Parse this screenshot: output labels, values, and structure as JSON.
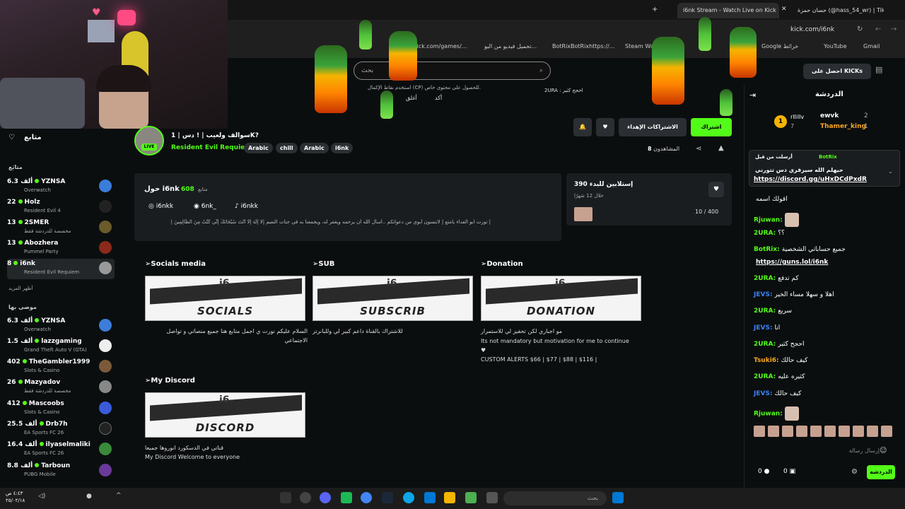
{
  "browser": {
    "tabs": [
      {
        "label": "حسان حمزة (@hass_54_wr) | TikTok",
        "active": false
      },
      {
        "label": "i6nk Stream - Watch Live on Kick",
        "active": true
      }
    ],
    "url": "kick.com/i6nk",
    "bookmarks": [
      "kick.com/games/...",
      "تحميل فيديو من اليو...",
      "BotRixBotRixhttps://...",
      "Steam Worksho...",
      "Google خرائط",
      "YouTube",
      "Gmail"
    ]
  },
  "site": {
    "search_placeholder": "بحث",
    "kicks_button": "احصل على KICKs",
    "notice_line": "استخدم نقاط الإكمال (CP) للحصول على محتوى خاص.",
    "notice_user": "2URA : احجح كثير",
    "notice_yes": "أكد",
    "notice_close": "أغلق"
  },
  "left_sidebar": {
    "following_heading": "متابع",
    "following_section": "متابَع",
    "show_more": "أظهر المزيد",
    "recommended_section": "موصى بها",
    "following": [
      {
        "viewers": "6.3 ألف",
        "name": "YZNSA",
        "game": "Overwatch",
        "selected": false
      },
      {
        "viewers": "22",
        "name": "Holz",
        "game": "Resident Evil 4",
        "selected": false
      },
      {
        "viewers": "13",
        "name": "2SMER",
        "game": "مخصصة للدردشة فقط",
        "selected": false
      },
      {
        "viewers": "13",
        "name": "Abozhera",
        "game": "Pummel Party",
        "selected": false
      },
      {
        "viewers": "8",
        "name": "i6nk",
        "game": "Resident Evil Requiem",
        "selected": true
      }
    ],
    "recommended": [
      {
        "viewers": "6.3 ألف",
        "name": "YZNSA",
        "game": "Overwatch"
      },
      {
        "viewers": "1.5 ألف",
        "name": "lazzgaming",
        "game": "Grand Theft Auto V (GTA)"
      },
      {
        "viewers": "402",
        "name": "TheGambler1999",
        "game": "Slots & Casino"
      },
      {
        "viewers": "26",
        "name": "Mazyadov",
        "game": "مخصصة للدردشة فقط"
      },
      {
        "viewers": "412",
        "name": "Mascoobs",
        "game": "Slots & Casino"
      },
      {
        "viewers": "25.5 ألف",
        "name": "Drb7h",
        "game": "EA Sports FC 26"
      },
      {
        "viewers": "16.4 ألف",
        "name": "ilyaselmaliki",
        "game": "EA Sports FC 26"
      },
      {
        "viewers": "8.8 ألف",
        "name": "Tarboun",
        "game": "PUBG Mobile"
      }
    ]
  },
  "stream": {
    "title": "سوالف ولعيب | ! دس | 1K?",
    "game": "Resident Evil Requiem",
    "tags": [
      "Arabic",
      "chill",
      "Arabic",
      "i6nk"
    ],
    "live_badge": "LIVE",
    "follow_label": "اشتراك",
    "subgift_label": "الاشتراكات الإهداء",
    "viewers_label": "المشاهدون",
    "viewers_count": "8"
  },
  "about": {
    "heading": "حول i6nk",
    "followers_count": "608",
    "followers_label": "متابع",
    "socials": [
      "i6nkk",
      "6nk_",
      "i6nkk"
    ],
    "bio": "| نورت ابو الفداء يامتع | لاتنسون أبوي من دعواتكم ..أسأل الله أن يرحمه ويغفر له، ويجمعنا به في جنات النعيم |لا إِلَهَ إِلَّا أَنْتَ سُبْحَانَكَ إِنِّي كُنْتُ مِنَ الظَّالِمِينَ |"
  },
  "goal": {
    "title": "إستلابين للبدء 390",
    "subtitle": "خلال 12 شهرًا",
    "progress": "10 / 400"
  },
  "panels": [
    {
      "title": "➢Socials media",
      "image_text": "SOCIALS",
      "lines": [
        "السلام عليكم نورت ي اجمل متابع هنا جميع منصاتي و تواصل الاجتماعي"
      ]
    },
    {
      "title": "➢SUB",
      "image_text": "SUBSCRIB",
      "lines": [
        "للاشتراك بالقناة داعم كبير لي وللبانرتر"
      ]
    },
    {
      "title": "➢Donation",
      "image_text": "DONATION",
      "lines": [
        "مو اجباري لكن تحفيز لي للاستمرار",
        "Its not mandatory but motivation for me to continue",
        "♥",
        "CUSTOM ALERTS $66 | $77 | $88 | $116 |"
      ]
    },
    {
      "title": "➢My Discord",
      "image_text": "DISCORD",
      "lines": [
        "قناتي في الدسكورد انوروها جميعا",
        "My Discord Welcome to everyone"
      ]
    }
  ],
  "chat": {
    "heading": "الدردشة",
    "leaderboard": [
      {
        "rank": "1",
        "name": "rllillv",
        "count": "7"
      },
      {
        "rank": "",
        "name": "ewvk",
        "count": "2"
      },
      {
        "rank": "",
        "name": "Thamer_king",
        "count": "1"
      }
    ],
    "pinned": {
      "by": "أرسلت من قبل",
      "author": "BotRix",
      "text": "حيهلم الله سيرفري دس تتورني",
      "link": "https://discord.gg/uHxDCdPxdR"
    },
    "messages": [
      {
        "user": "",
        "text": "اقولك اسمه",
        "color": "cw"
      },
      {
        "user": "Rjuwan:",
        "text": "",
        "color": "g2",
        "emote": true
      },
      {
        "user": "2URA:",
        "text": "؟؟",
        "color": "g2"
      },
      {
        "user": "BotRix:",
        "text": "جميع حساباتي الشخصية",
        "color": "g2"
      },
      {
        "user": "",
        "text": "https://guns.lol/i6nk",
        "color": "cw"
      },
      {
        "user": "2URA:",
        "text": "كم تدفع",
        "color": "g2"
      },
      {
        "user": "JEVS:",
        "text": "اهلا و سهلا مساء الخير",
        "color": "cb"
      },
      {
        "user": "2URA:",
        "text": "سريع",
        "color": "g2"
      },
      {
        "user": "JEVS:",
        "text": "انا",
        "color": "cb"
      },
      {
        "user": "2URA:",
        "text": "احجح كثير",
        "color": "g2"
      },
      {
        "user": "Tsuki6:",
        "text": "كيف حالك",
        "color": "co"
      },
      {
        "user": "2URA:",
        "text": "كثيره عليه",
        "color": "g2"
      },
      {
        "user": "JEVS:",
        "text": "كيف حالك",
        "color": "cb"
      },
      {
        "user": "Rjuwan:",
        "text": "",
        "color": "g2",
        "emote": true
      }
    ],
    "input_placeholder": "إرسال رسالة",
    "send_label": "الدردشة",
    "points_a": "0",
    "points_b": "0"
  },
  "taskbar": {
    "search_placeholder": "بحث",
    "clock_time": "٤:٤٣ ص",
    "clock_date": "٢٥/٠٢/١٨"
  },
  "colors": {
    "accent": "#53fc18",
    "bg": "#0b0e0f",
    "card": "#1a1d20"
  }
}
